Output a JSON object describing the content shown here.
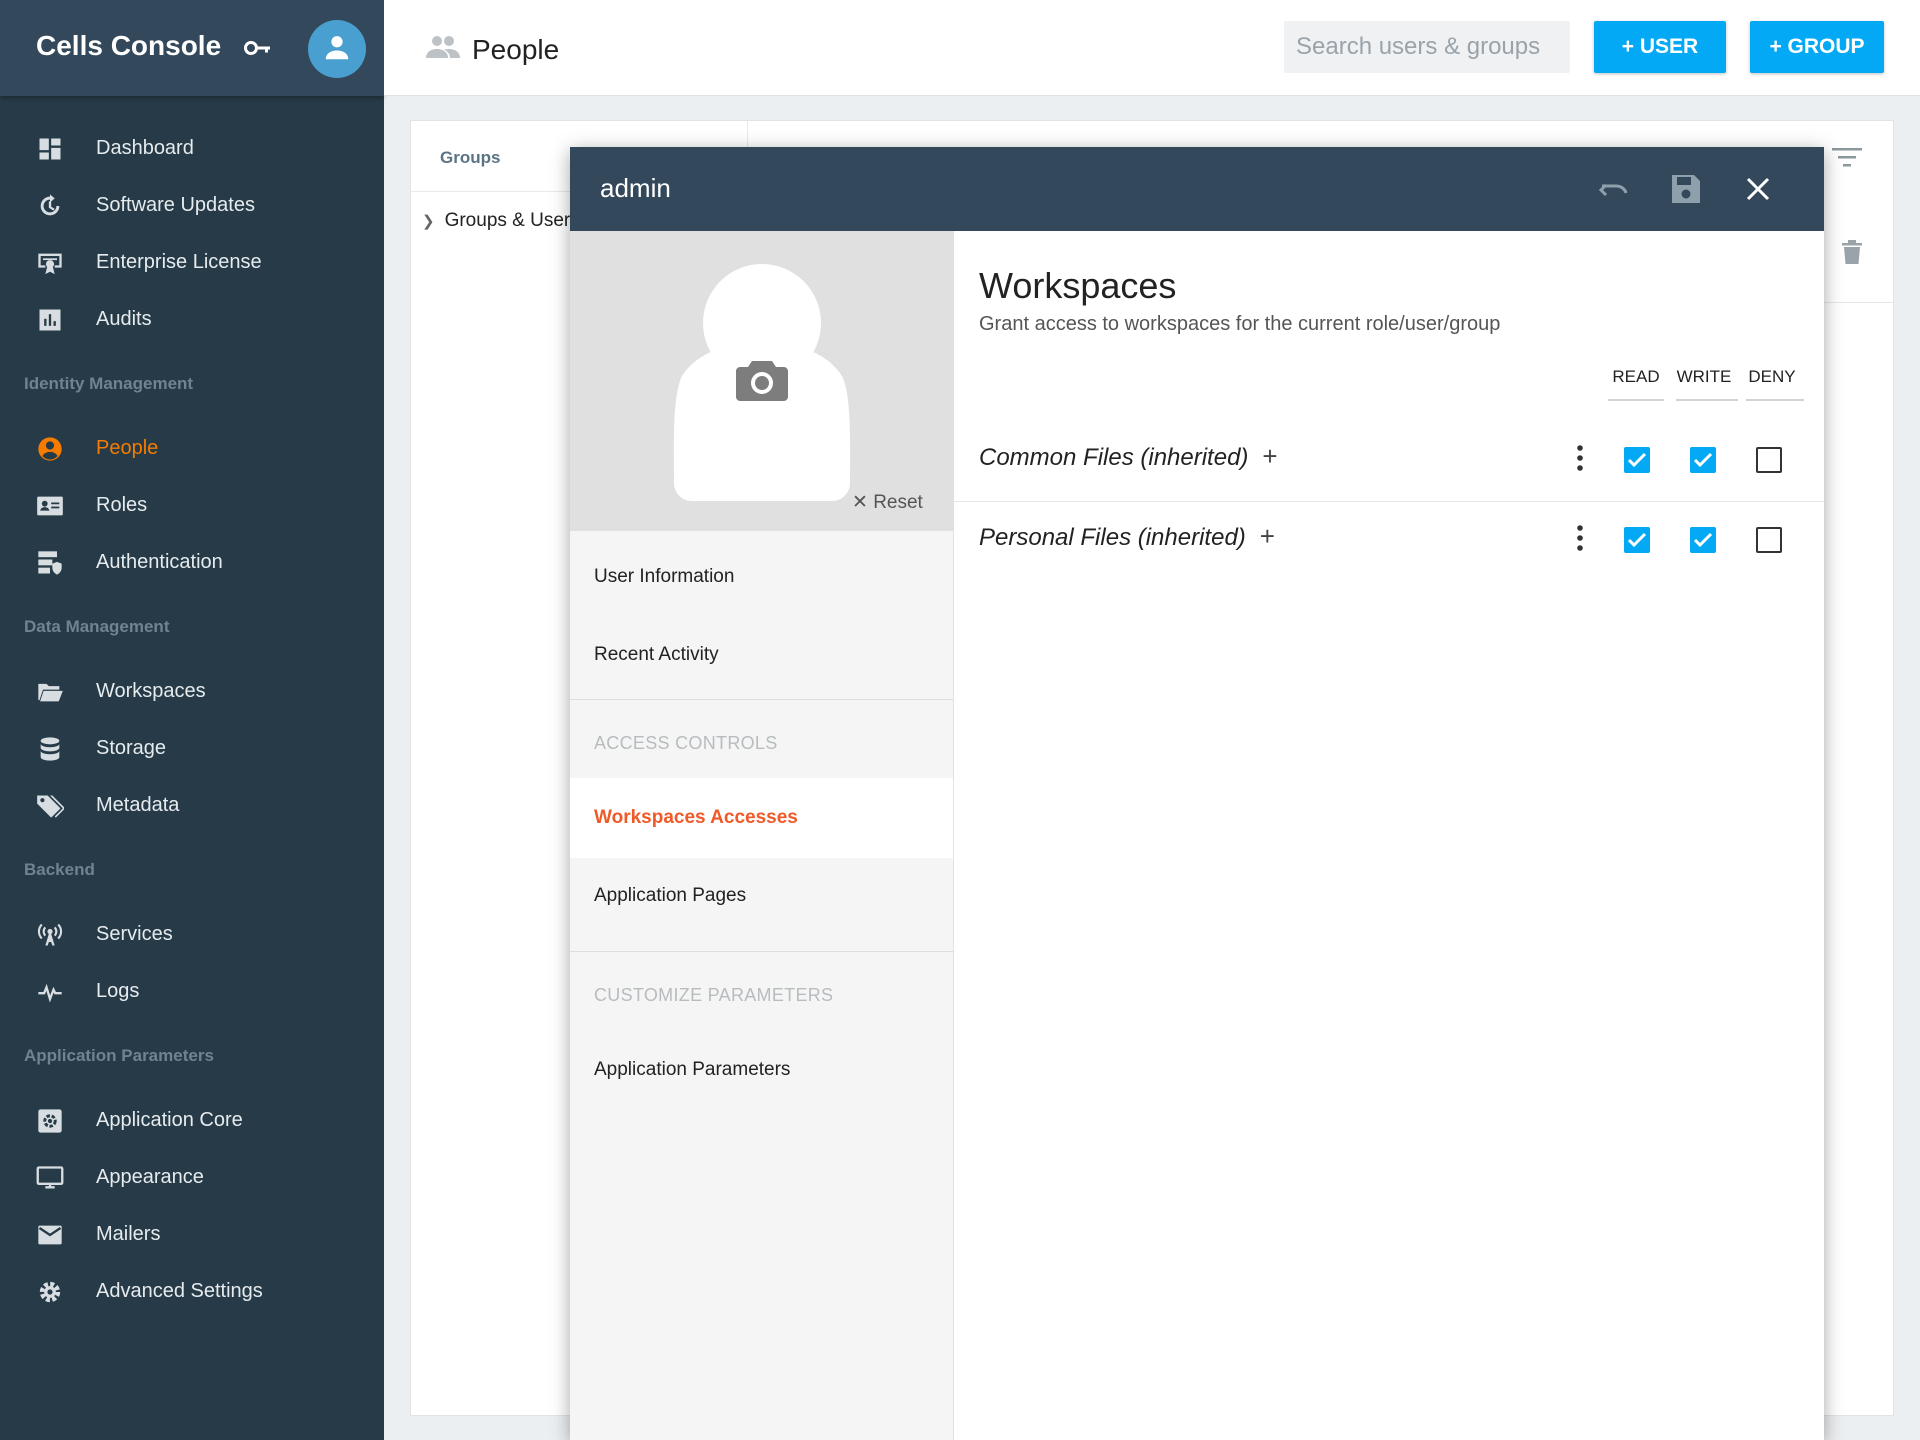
{
  "app": {
    "title": "Cells Console"
  },
  "sidebar": {
    "sections": {
      "identity": "Identity Management",
      "data": "Data Management",
      "backend": "Backend",
      "params": "Application Parameters"
    },
    "items": [
      {
        "label": "Dashboard",
        "icon": "dashboard-icon"
      },
      {
        "label": "Software Updates",
        "icon": "update-icon"
      },
      {
        "label": "Enterprise License",
        "icon": "certificate-icon"
      },
      {
        "label": "Audits",
        "icon": "chart-icon"
      },
      {
        "label": "People",
        "icon": "account-circle-icon"
      },
      {
        "label": "Roles",
        "icon": "id-card-icon"
      },
      {
        "label": "Authentication",
        "icon": "server-security-icon"
      },
      {
        "label": "Workspaces",
        "icon": "folder-open-icon"
      },
      {
        "label": "Storage",
        "icon": "database-icon"
      },
      {
        "label": "Metadata",
        "icon": "tags-icon"
      },
      {
        "label": "Services",
        "icon": "access-point-icon"
      },
      {
        "label": "Logs",
        "icon": "pulse-icon"
      },
      {
        "label": "Application Core",
        "icon": "settings-box-icon"
      },
      {
        "label": "Appearance",
        "icon": "monitor-icon"
      },
      {
        "label": "Mailers",
        "icon": "email-icon"
      },
      {
        "label": "Advanced Settings",
        "icon": "gear-icon"
      }
    ]
  },
  "header": {
    "title": "People",
    "search_placeholder": "Search users & groups",
    "add_user": "+ USER",
    "add_group": "+ GROUP"
  },
  "background": {
    "groups_header": "Groups",
    "tree_item": "Groups & Users"
  },
  "modal": {
    "title": "admin",
    "reset": "Reset",
    "menu": {
      "user_info": "User Information",
      "recent_activity": "Recent Activity",
      "access_controls": "ACCESS CONTROLS",
      "workspaces_accesses": "Workspaces Accesses",
      "application_pages": "Application Pages",
      "customize_parameters": "CUSTOMIZE PARAMETERS",
      "application_parameters": "Application Parameters"
    },
    "workspaces": {
      "title": "Workspaces",
      "subtitle": "Grant access to workspaces for the current role/user/group",
      "columns": {
        "read": "READ",
        "write": "WRITE",
        "deny": "DENY"
      },
      "rows": [
        {
          "name": "Common Files (inherited)",
          "plus": "+",
          "read": true,
          "write": true,
          "deny": false
        },
        {
          "name": "Personal Files (inherited)",
          "plus": "+",
          "read": true,
          "write": true,
          "deny": false
        }
      ]
    }
  },
  "colors": {
    "accent": "#03a9f4",
    "active": "#f57c00",
    "sidebar": "#263a47",
    "header": "#33485a"
  }
}
